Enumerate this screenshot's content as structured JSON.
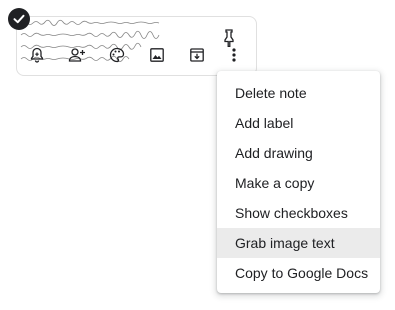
{
  "note": {
    "text_lines": [
      "this text is significantly longer, so it will be",
      "automatically reduced to fit within the note.",
      "The scanned text is truly hard to make",
      "for the best readable and printed image"
    ],
    "selected": true
  },
  "toolbar": {
    "icons": [
      "remind-me-icon",
      "collaborator-icon",
      "background-options-icon",
      "add-image-icon",
      "archive-icon",
      "more-icon"
    ]
  },
  "menu": {
    "items": [
      {
        "label": "Delete note"
      },
      {
        "label": "Add label"
      },
      {
        "label": "Add drawing"
      },
      {
        "label": "Make a copy"
      },
      {
        "label": "Show checkboxes"
      },
      {
        "label": "Grab image text"
      },
      {
        "label": "Copy to Google Docs"
      }
    ],
    "highlighted_index": 5
  },
  "colors": {
    "text": "#202124",
    "hover": "#ebebeb",
    "icon": "#5f6368"
  }
}
